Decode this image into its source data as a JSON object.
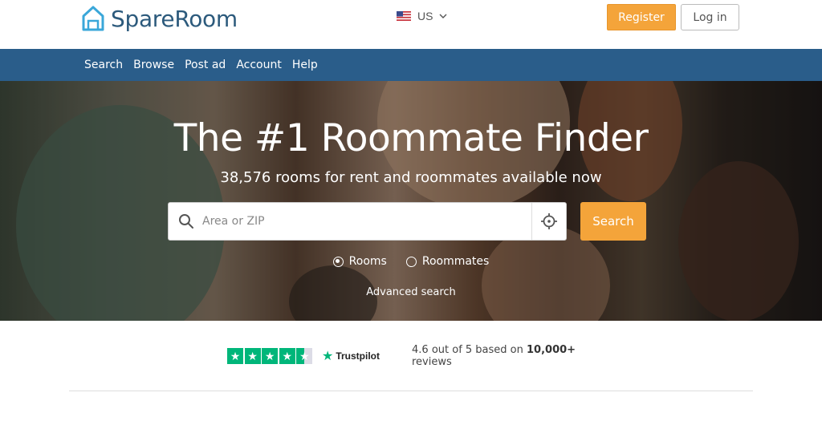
{
  "header": {
    "logo_text": "SpareRoom",
    "locale_label": "US",
    "register_label": "Register",
    "login_label": "Log in"
  },
  "nav": {
    "items": [
      "Search",
      "Browse",
      "Post ad",
      "Account",
      "Help"
    ]
  },
  "hero": {
    "title": "The #1 Roommate Finder",
    "subtitle": "38,576 rooms for rent and roommates available now",
    "search_placeholder": "Area or ZIP",
    "search_value": "",
    "search_button": "Search",
    "radio_rooms": "Rooms",
    "radio_roommates": "Roommates",
    "selected_option": "Rooms",
    "advanced_search": "Advanced search"
  },
  "trust": {
    "brand": "Trustpilot",
    "rating": "4.6",
    "text_prefix": "out of 5 based on",
    "review_count": "10,000+",
    "text_suffix": "reviews",
    "stars": 4.5
  },
  "colors": {
    "accent": "#f4a43a",
    "nav_bg": "#2a5d8a",
    "logo": "#2c5a7c",
    "trustpilot_green": "#00b67a"
  },
  "icons": [
    "home-logo-icon",
    "us-flag-icon",
    "chevron-down-icon",
    "search-icon",
    "crosshair-icon",
    "trustpilot-star-icon"
  ]
}
